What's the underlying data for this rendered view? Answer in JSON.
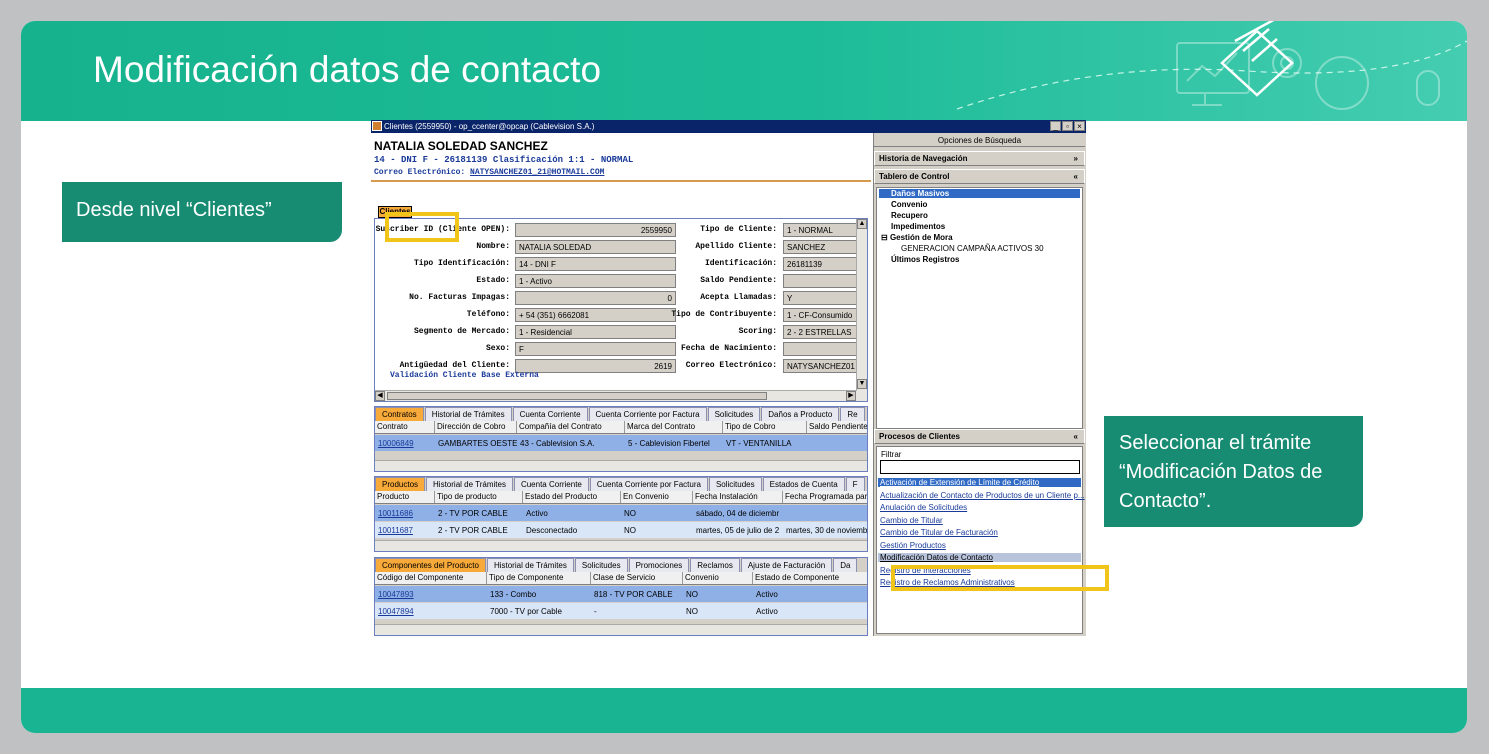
{
  "slide": {
    "title": "Modificación datos de contacto",
    "callout_left": "Desde nivel “Clientes”",
    "callout_right": "Seleccionar el trámite “Modificación Datos de Contacto”."
  },
  "window": {
    "title": "Clientes (2559950) - op_ccenter@opcap (Cablevision S.A.)",
    "buttons": [
      "_",
      "▫",
      "×"
    ]
  },
  "customer": {
    "name": "NATALIA SOLEDAD SANCHEZ",
    "line2": "14 - DNI F - 26181139 Clasificación 1:1 - NORMAL",
    "email_label": "Correo Electrónico:",
    "email": "NATYSANCHEZ01_21@HOTMAIL.COM"
  },
  "form": {
    "tab": "Clientes",
    "left_fields": [
      {
        "label": "Suscriber ID (Cliente OPEN):",
        "value": "2559950",
        "num": true
      },
      {
        "label": "Nombre:",
        "value": "NATALIA SOLEDAD",
        "num": false
      },
      {
        "label": "Tipo Identificación:",
        "value": "14 - DNI F",
        "num": false
      },
      {
        "label": "Estado:",
        "value": "1 - Activo",
        "num": false
      },
      {
        "label": "No. Facturas Impagas:",
        "value": "0",
        "num": true
      },
      {
        "label": "Teléfono:",
        "value": "+ 54 (351) 6662081",
        "num": false
      },
      {
        "label": "Segmento de Mercado:",
        "value": "1 - Residencial",
        "num": false
      },
      {
        "label": "Sexo:",
        "value": "F",
        "num": false
      },
      {
        "label": "Antigüedad del Cliente:",
        "value": "2619",
        "num": true
      }
    ],
    "right_fields": [
      {
        "label": "Tipo de Cliente:",
        "value": "1 - NORMAL"
      },
      {
        "label": "Apellido Cliente:",
        "value": "SANCHEZ"
      },
      {
        "label": "Identificación:",
        "value": "26181139"
      },
      {
        "label": "Saldo Pendiente:",
        "value": ""
      },
      {
        "label": "Acepta Llamadas:",
        "value": "Y"
      },
      {
        "label": "Tipo de Contribuyente:",
        "value": "1 - CF-Consumido"
      },
      {
        "label": "Scoring:",
        "value": "2 - 2 ESTRELLAS"
      },
      {
        "label": "Fecha de Nacimiento:",
        "value": ""
      },
      {
        "label": "Correo Electrónico:",
        "value": "NATYSANCHEZ01"
      }
    ],
    "validacion": "Validación Cliente Base Externa"
  },
  "contratos": {
    "tabs": [
      "Contratos",
      "Historial de Trámites",
      "Cuenta Corriente",
      "Cuenta Corriente por Factura",
      "Solicitudes",
      "Daños a Producto",
      "Re"
    ],
    "headers": [
      "Contrato",
      "Dirección de Cobro",
      "Compañía del Contrato",
      "Marca del Contrato",
      "Tipo de Cobro",
      "Saldo Pendiente"
    ],
    "rows": [
      [
        "10006849",
        "GAMBARTES OESTE /",
        "43 - Cablevision S.A.",
        "5 - Cablevision Fibertel",
        "VT - VENTANILLA",
        ""
      ]
    ]
  },
  "productos": {
    "tabs": [
      "Productos",
      "Historial de Trámites",
      "Cuenta Corriente",
      "Cuenta Corriente por Factura",
      "Solicitudes",
      "Estados de Cuenta",
      "F"
    ],
    "headers": [
      "Producto",
      "Tipo de producto",
      "Estado del Producto",
      "En Convenio",
      "Fecha Instalación",
      "Fecha Programada para"
    ],
    "rows": [
      [
        "10011686",
        "2 - TV POR CABLE",
        "Activo",
        "NO",
        "sábado, 04 de diciembr",
        ""
      ],
      [
        "10011687",
        "2 - TV POR CABLE",
        "Desconectado",
        "NO",
        "martes, 05 de julio de 2",
        "martes, 30 de noviembr"
      ]
    ]
  },
  "componentes": {
    "tabs": [
      "Componentes del Producto",
      "Historial de Trámites",
      "Solicitudes",
      "Promociones",
      "Reclamos",
      "Ajuste de Facturación",
      "Da"
    ],
    "headers": [
      "Código del Componente",
      "Tipo de Componente",
      "Clase de Servicio",
      "Convenio",
      "Estado de Componente"
    ],
    "rows": [
      [
        "10047893",
        "133 - Combo",
        "818 - TV POR CABLE",
        "NO",
        "Activo"
      ],
      [
        "10047894",
        "7000 - TV por Cable",
        "-",
        "NO",
        "Activo"
      ]
    ]
  },
  "right_panel": {
    "title": "Opciones de Búsqueda",
    "historia": "Historia de Navegación",
    "tablero": "Tablero de Control",
    "tree": [
      "Daños Masivos",
      "Convenio",
      "Recupero",
      "Impedimentos",
      "Gestión de Mora",
      "GENERACION CAMPAÑA ACTIVOS 30",
      "Últimos Registros"
    ],
    "procesos_title": "Procesos de Clientes",
    "filtrar": "Filtrar",
    "procesos": [
      "Activación de Extensión de Límite de Crédito",
      "Actualización de Contacto de Productos de un Cliente p...",
      "Anulación de Solicitudes",
      "Cambio de Titular",
      "Cambio de Titular de Facturación",
      "Gestión Productos",
      "Modificación Datos de Contacto",
      "Registro de Interacciones",
      "Registro de Reclamos Administrativos"
    ]
  },
  "colors": {
    "banner": "#1dbc98",
    "callout": "#178c73",
    "highlight": "#f0c419"
  }
}
